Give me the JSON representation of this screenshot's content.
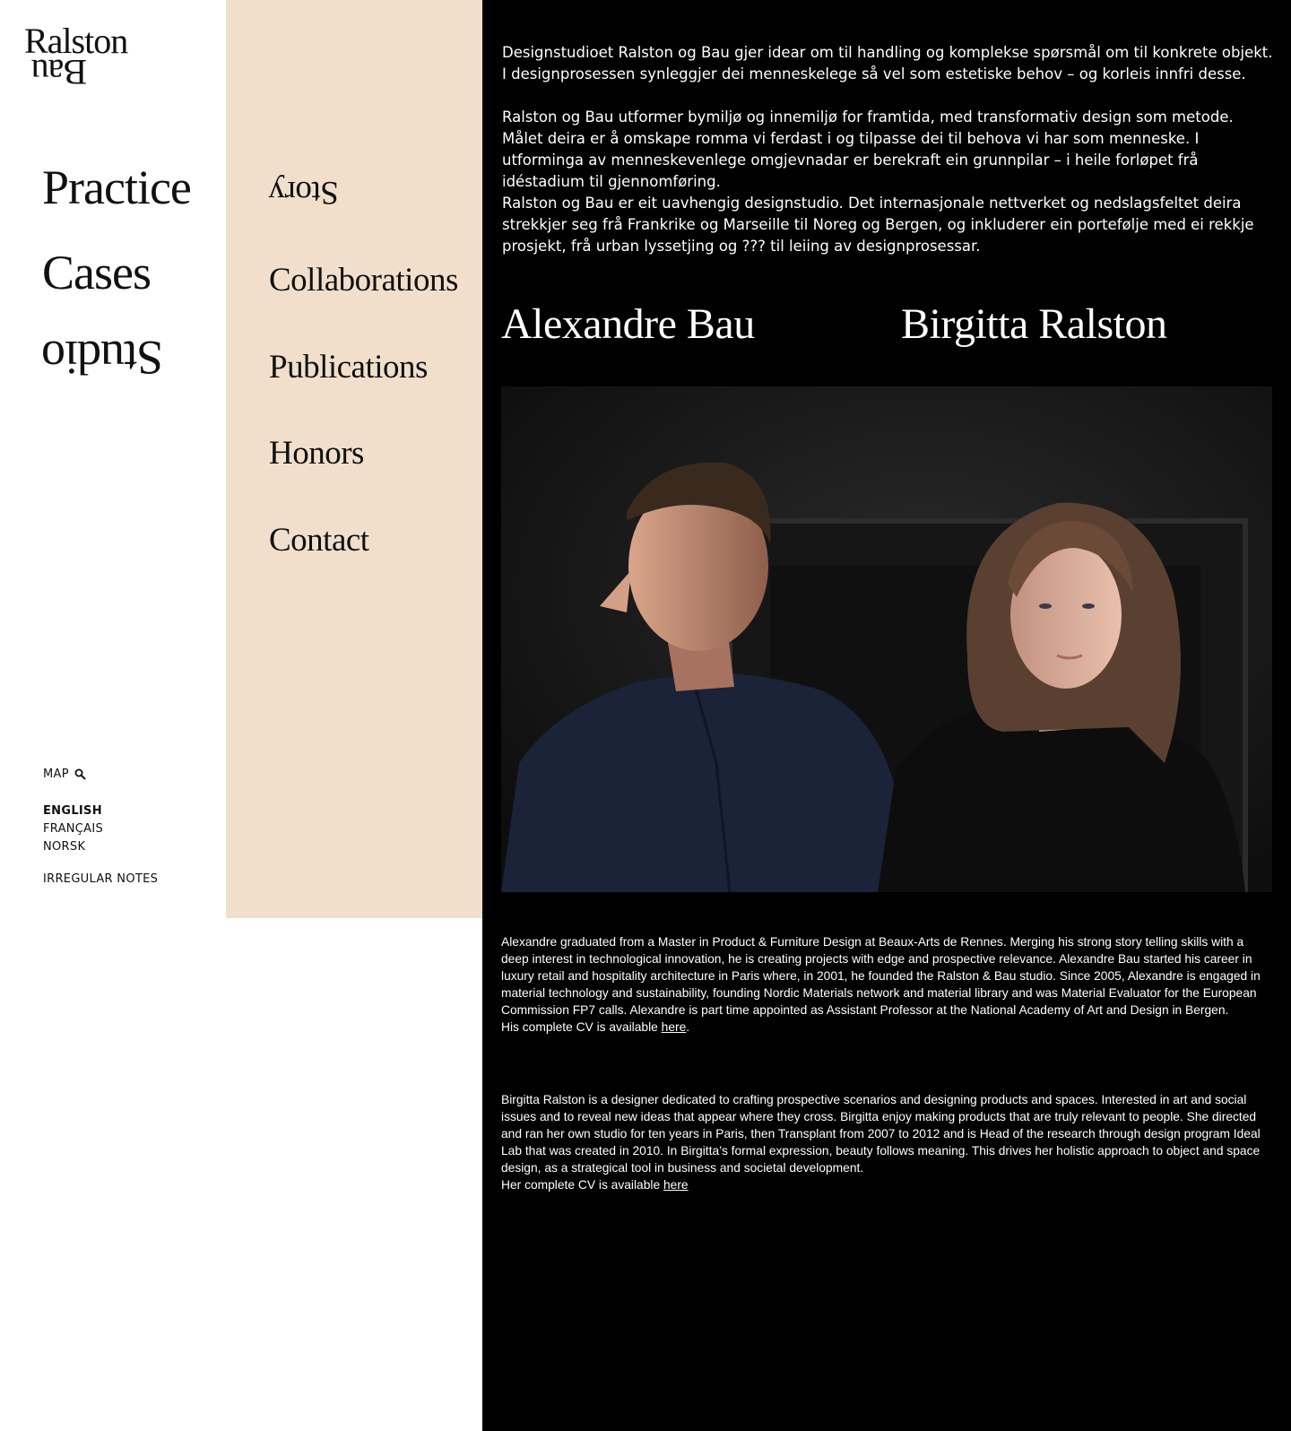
{
  "logo": {
    "line1": "Ralston",
    "line2": "Bau"
  },
  "main_nav": [
    {
      "label": "Practice"
    },
    {
      "label": "Cases"
    },
    {
      "label": "Studio"
    }
  ],
  "sub_nav": [
    {
      "label": "Story"
    },
    {
      "label": "Collaborations"
    },
    {
      "label": "Publications"
    },
    {
      "label": "Honors"
    },
    {
      "label": "Contact"
    }
  ],
  "utility": {
    "map_label": "MAP",
    "languages": [
      "ENGLISH",
      "FRANÇAIS",
      "NORSK"
    ],
    "active_language": "ENGLISH",
    "notes_label": "IRREGULAR NOTES"
  },
  "intro": {
    "p1": "Designstudioet Ralston og Bau gjer idear om til handling og komplekse spørsmål om til konkrete objekt. I designprosessen synleggjer dei menneskelege så vel som estetiske behov – og korleis innfri desse.",
    "p2": "Ralston og Bau utformer bymiljø og innemiljø for framtida, med transformativ design som metode. Målet deira er å omskape romma vi ferdast i og tilpasse dei til behova vi har som menneske. I utforminga av menneskevenlege omgjevnadar er berekraft ein grunnpilar – i heile forløpet frå idéstadium til gjennomføring.",
    "p3": "Ralston og Bau er eit uavhengig designstudio. Det internasjonale nettverket og nedslagsfeltet deira strekkjer seg frå Frankrike og Marseille til Noreg og Bergen, og inkluderer ein portefølje med ei rekkje prosjekt, frå urban lyssetjing og ??? til leiing av designprosessar."
  },
  "people": {
    "left_name": "Alexandre Bau",
    "right_name": "Birgitta Ralston"
  },
  "bios": {
    "alexandre": "Alexandre graduated from a Master in Product & Furniture Design at Beaux-Arts de Rennes. Merging his strong story telling skills with a deep interest in technological innovation, he is creating projects with edge and prospective relevance. Alexandre Bau started his career in luxury retail and hospitality architecture in Paris where, in 2001, he founded the Ralston & Bau studio. Since 2005, Alexandre is engaged in material technology and sustainability, founding Nordic Materials network and material library and was Material Evaluator for the European Commission FP7 calls. Alexandre is part time appointed as Assistant Professor at the National Academy of Art and Design in Bergen.",
    "alexandre_cv_prefix": "His complete CV is available ",
    "alexandre_cv_link": "here",
    "alexandre_cv_suffix": ".",
    "birgitta": "Birgitta Ralston is a designer dedicated to crafting prospective scenarios and designing products and spaces. Interested in art and social issues and to reveal new ideas that appear where they cross. Birgitta enjoy making products that are truly relevant to people. She directed and ran her own studio for ten years in Paris, then Transplant from 2007 to 2012 and is Head of the research through design program Ideal Lab that was created in 2010. In Birgitta’s formal expression, beauty follows meaning. This drives her holistic approach to object and space design, as a strategical tool in business and societal development.",
    "birgitta_cv_prefix": "Her complete CV is available ",
    "birgitta_cv_link": "here"
  },
  "colors": {
    "middle_panel": "#f1dfcc",
    "right_panel": "#000000",
    "text_dark": "#111111"
  }
}
